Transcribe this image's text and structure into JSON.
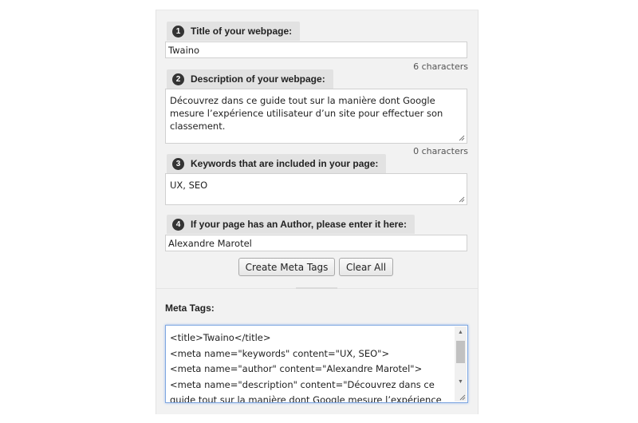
{
  "steps": [
    {
      "num": "1",
      "label": "Title of your webpage:"
    },
    {
      "num": "2",
      "label": "Description of your webpage:"
    },
    {
      "num": "3",
      "label": "Keywords that are included in your page:"
    },
    {
      "num": "4",
      "label": "If your page has an Author, please enter it here:"
    }
  ],
  "fields": {
    "title_value": "Twaino",
    "title_count": "6 characters",
    "description_value": "Découvrez dans ce guide tout sur la manière dont Google mesure l’expérience utilisateur d’un site pour effectuer son classement.",
    "description_count": "0 characters",
    "keywords_value": "UX, SEO",
    "author_value": "Alexandre Marotel"
  },
  "buttons": {
    "create": "Create Meta Tags",
    "clear": "Clear All"
  },
  "output": {
    "heading": "Meta Tags:",
    "lines": [
      "<title>Twaino</title>",
      "<meta name=\"keywords\" content=\"UX, SEO\">",
      "<meta name=\"author\" content=\"Alexandre Marotel\">",
      "<meta name=\"description\" content=\"Découvrez dans ce guide tout sur la manière dont Google mesure l’expérience"
    ]
  },
  "icons": {
    "scroll_up": "triangle-up-icon",
    "scroll_down": "triangle-down-icon",
    "resize": "resize-grip-icon"
  }
}
